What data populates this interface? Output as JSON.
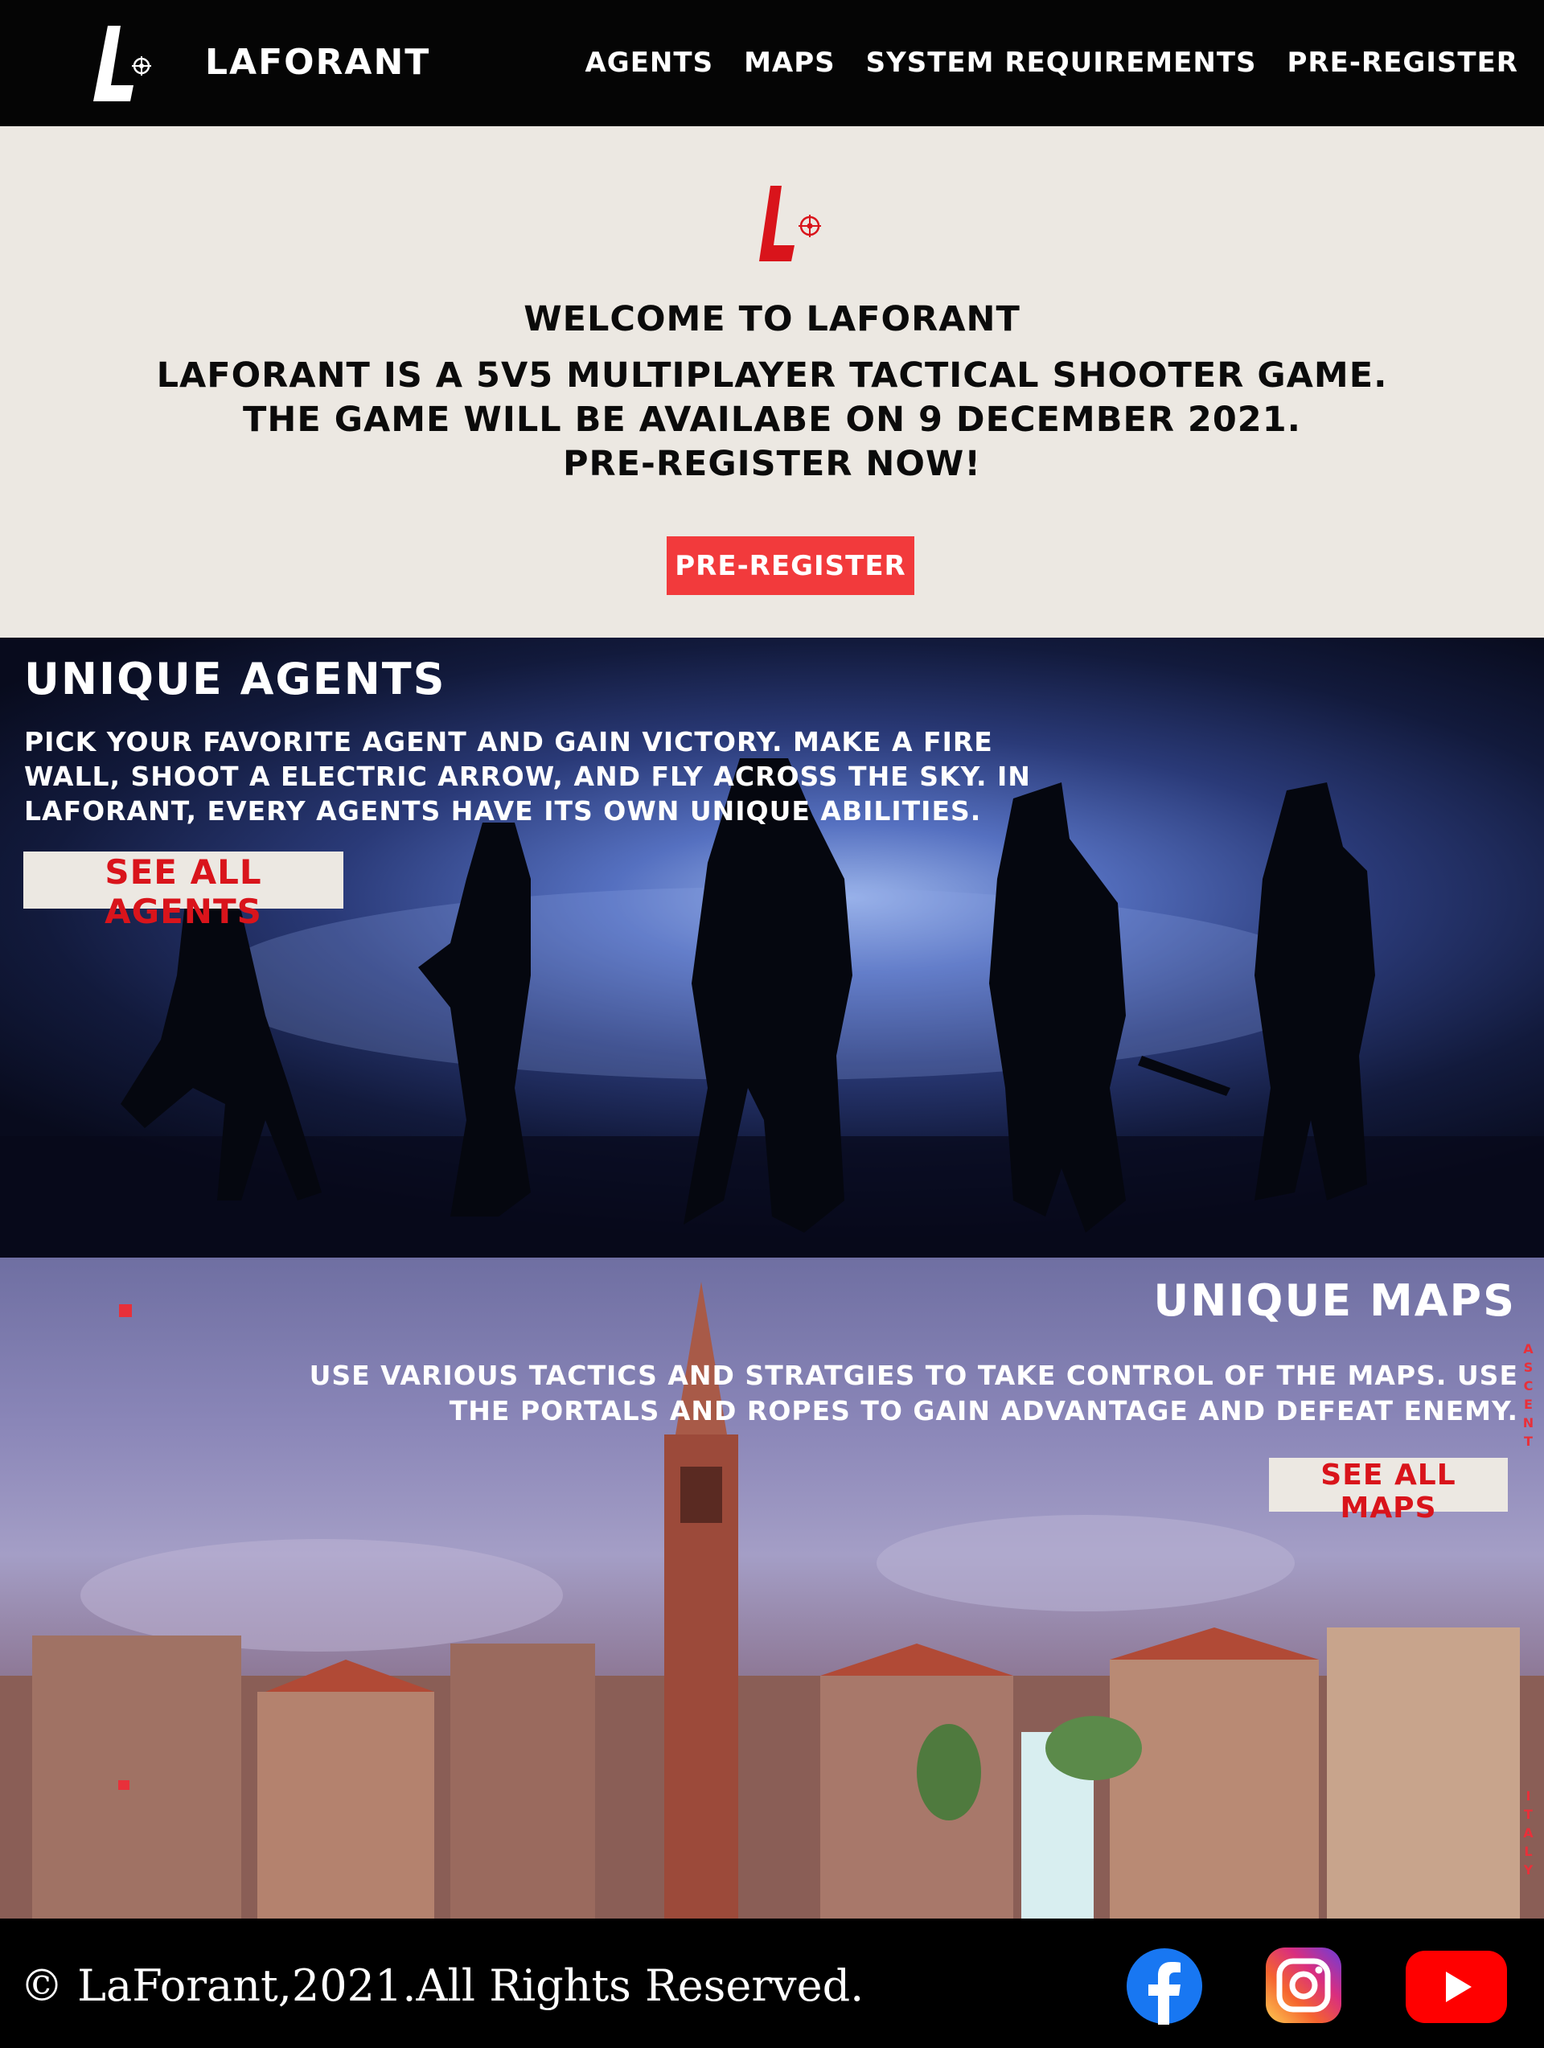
{
  "header": {
    "brand": "LAFORANT",
    "nav": [
      {
        "label": "AGENTS"
      },
      {
        "label": "MAPS"
      },
      {
        "label": "SYSTEM REQUIREMENTS"
      },
      {
        "label": "PRE-REGISTER"
      }
    ]
  },
  "hero": {
    "welcome": "WELCOME TO LAFORANT",
    "line1": "LAFORANT IS A 5V5 MULTIPLAYER TACTICAL SHOOTER GAME.",
    "line2": "THE GAME WILL BE AVAILABE ON 9 DECEMBER 2021.",
    "line3": "PRE-REGISTER NOW!",
    "cta_label": "PRE-REGISTER"
  },
  "agents": {
    "title": "UNIQUE AGENTS",
    "description": "PICK YOUR FAVORITE AGENT AND GAIN VICTORY. MAKE A FIRE WALL, SHOOT A ELECTRIC ARROW, AND FLY ACROSS THE SKY. IN LAFORANT, EVERY AGENTS HAVE ITS OWN UNIQUE ABILITIES.",
    "button_label": "SEE ALL AGENTS"
  },
  "maps": {
    "title": "UNIQUE MAPS",
    "description": "USE VARIOUS TACTICS AND STRATGIES TO TAKE CONTROL OF THE MAPS. USE THE PORTALS AND ROPES TO GAIN ADVANTAGE AND DEFEAT ENEMY.",
    "button_label": "SEE ALL MAPS",
    "side_text_top": "ASCENT",
    "side_text_bottom": "ITALY"
  },
  "footer": {
    "copyright": "© LaForant,2021.All Rights Reserved.",
    "social": [
      {
        "icon": "facebook-icon"
      },
      {
        "icon": "instagram-icon"
      },
      {
        "icon": "youtube-icon"
      }
    ]
  },
  "colors": {
    "accent": "#f23a3c",
    "brand_red": "#d9141b",
    "header_bg": "#050505",
    "hero_bg": "#ece8e2"
  }
}
